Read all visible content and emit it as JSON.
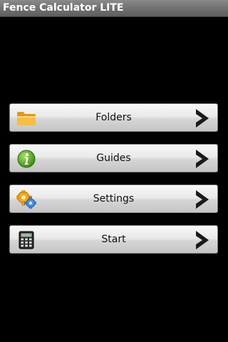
{
  "app": {
    "title": "Fence Calculator LITE"
  },
  "menu": {
    "items": [
      {
        "label": "Folders",
        "icon": "folder-icon"
      },
      {
        "label": "Guides",
        "icon": "info-icon"
      },
      {
        "label": "Settings",
        "icon": "gears-icon"
      },
      {
        "label": "Start",
        "icon": "calculator-icon"
      }
    ],
    "chevron_icon": "chevron-right-icon"
  },
  "colors": {
    "background": "#000000",
    "titlebar": "#6f6f6f",
    "button_face": "#e3e3e3",
    "folder": "#f2b234",
    "info": "#6bb026",
    "calculator": "#2a2a2a"
  }
}
